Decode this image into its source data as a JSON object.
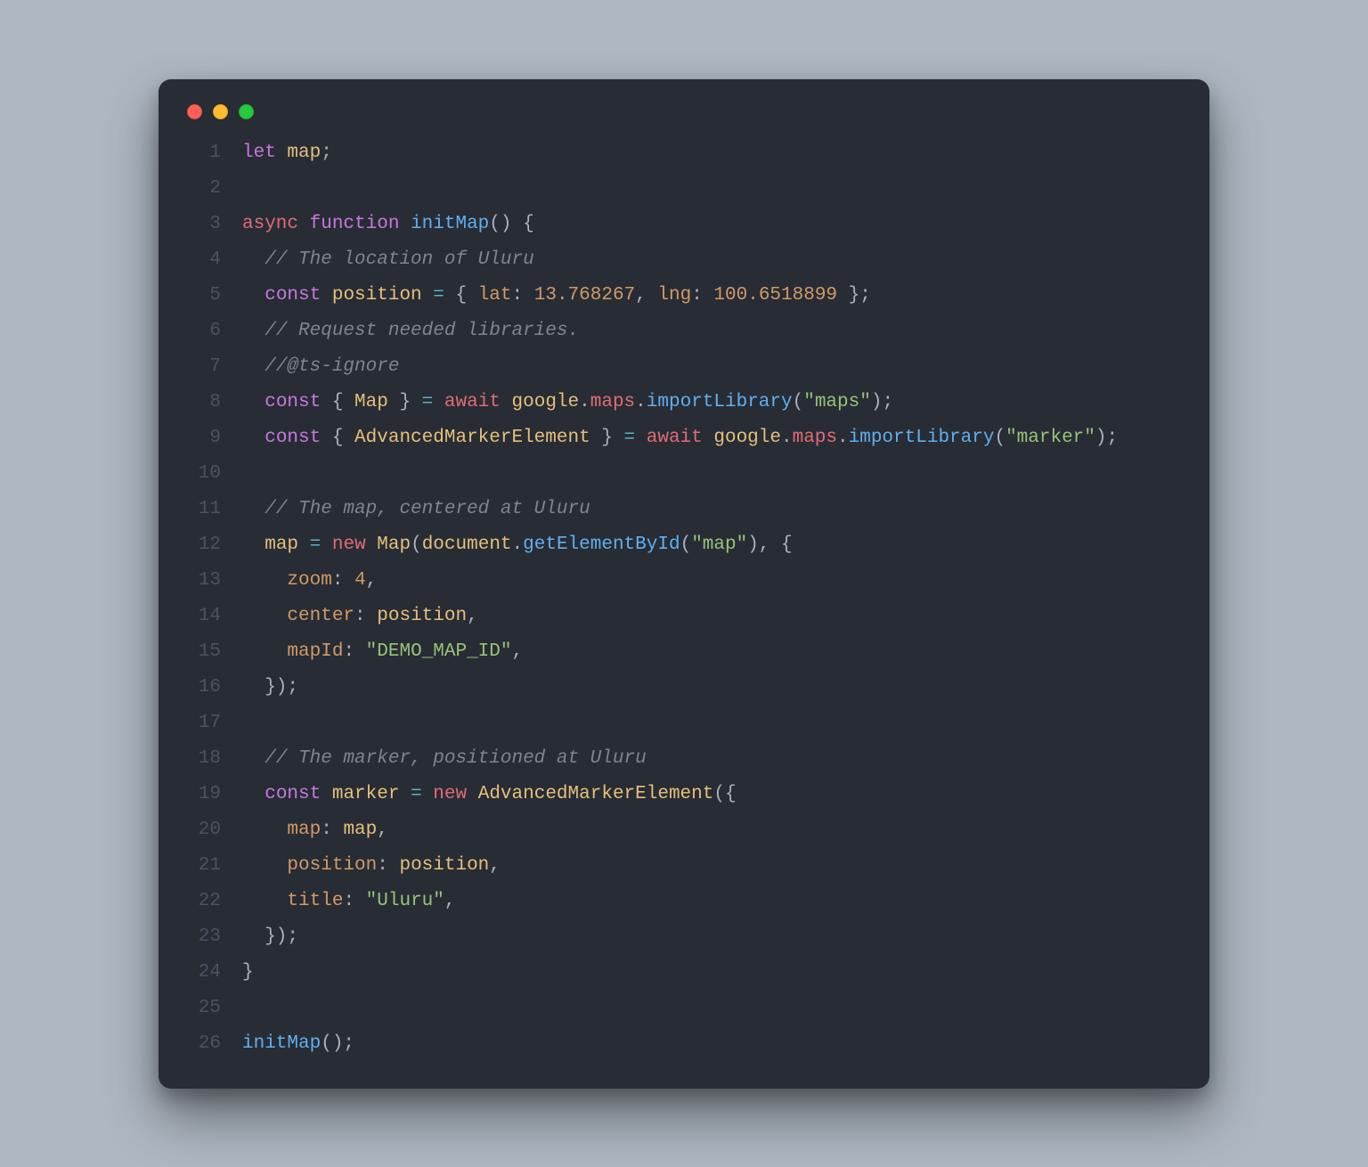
{
  "window": {
    "traffic_light_colors": {
      "close": "#ff5f56",
      "minimize": "#ffbd2e",
      "zoom": "#27c93f"
    }
  },
  "editor": {
    "theme": "one-dark",
    "background": "#282c34",
    "font": "monospace",
    "line_numbers": [
      "1",
      "2",
      "3",
      "4",
      "5",
      "6",
      "7",
      "8",
      "9",
      "10",
      "11",
      "12",
      "13",
      "14",
      "15",
      "16",
      "17",
      "18",
      "19",
      "20",
      "21",
      "22",
      "23",
      "24",
      "25",
      "26"
    ],
    "lines": [
      [
        {
          "t": "let",
          "c": "tk-kw"
        },
        {
          "t": " ",
          "c": "tk-punc"
        },
        {
          "t": "map",
          "c": "tk-var"
        },
        {
          "t": ";",
          "c": "tk-punc"
        }
      ],
      [],
      [
        {
          "t": "async",
          "c": "tk-def"
        },
        {
          "t": " ",
          "c": "tk-punc"
        },
        {
          "t": "function",
          "c": "tk-kw"
        },
        {
          "t": " ",
          "c": "tk-punc"
        },
        {
          "t": "initMap",
          "c": "tk-call"
        },
        {
          "t": "() {",
          "c": "tk-punc"
        }
      ],
      [
        {
          "t": "  ",
          "c": "tk-punc"
        },
        {
          "t": "// The location of Uluru",
          "c": "tk-cmnt"
        }
      ],
      [
        {
          "t": "  ",
          "c": "tk-punc"
        },
        {
          "t": "const",
          "c": "tk-kw"
        },
        {
          "t": " ",
          "c": "tk-punc"
        },
        {
          "t": "position",
          "c": "tk-var"
        },
        {
          "t": " ",
          "c": "tk-punc"
        },
        {
          "t": "=",
          "c": "tk-op"
        },
        {
          "t": " { ",
          "c": "tk-punc"
        },
        {
          "t": "lat",
          "c": "tk-attr"
        },
        {
          "t": ": ",
          "c": "tk-punc"
        },
        {
          "t": "13.768267",
          "c": "tk-num"
        },
        {
          "t": ", ",
          "c": "tk-punc"
        },
        {
          "t": "lng",
          "c": "tk-attr"
        },
        {
          "t": ": ",
          "c": "tk-punc"
        },
        {
          "t": "100.6518899",
          "c": "tk-num"
        },
        {
          "t": " };",
          "c": "tk-punc"
        }
      ],
      [
        {
          "t": "  ",
          "c": "tk-punc"
        },
        {
          "t": "// Request needed libraries.",
          "c": "tk-cmnt"
        }
      ],
      [
        {
          "t": "  ",
          "c": "tk-punc"
        },
        {
          "t": "//@ts-ignore",
          "c": "tk-cmnt"
        }
      ],
      [
        {
          "t": "  ",
          "c": "tk-punc"
        },
        {
          "t": "const",
          "c": "tk-kw"
        },
        {
          "t": " { ",
          "c": "tk-punc"
        },
        {
          "t": "Map",
          "c": "tk-type"
        },
        {
          "t": " } ",
          "c": "tk-punc"
        },
        {
          "t": "=",
          "c": "tk-op"
        },
        {
          "t": " ",
          "c": "tk-punc"
        },
        {
          "t": "await",
          "c": "tk-def"
        },
        {
          "t": " ",
          "c": "tk-punc"
        },
        {
          "t": "google",
          "c": "tk-var"
        },
        {
          "t": ".",
          "c": "tk-punc"
        },
        {
          "t": "maps",
          "c": "tk-prop"
        },
        {
          "t": ".",
          "c": "tk-punc"
        },
        {
          "t": "importLibrary",
          "c": "tk-call"
        },
        {
          "t": "(",
          "c": "tk-punc"
        },
        {
          "t": "\"maps\"",
          "c": "tk-str"
        },
        {
          "t": ");",
          "c": "tk-punc"
        }
      ],
      [
        {
          "t": "  ",
          "c": "tk-punc"
        },
        {
          "t": "const",
          "c": "tk-kw"
        },
        {
          "t": " { ",
          "c": "tk-punc"
        },
        {
          "t": "AdvancedMarkerElement",
          "c": "tk-type"
        },
        {
          "t": " } ",
          "c": "tk-punc"
        },
        {
          "t": "=",
          "c": "tk-op"
        },
        {
          "t": " ",
          "c": "tk-punc"
        },
        {
          "t": "await",
          "c": "tk-def"
        },
        {
          "t": " ",
          "c": "tk-punc"
        },
        {
          "t": "google",
          "c": "tk-var"
        },
        {
          "t": ".",
          "c": "tk-punc"
        },
        {
          "t": "maps",
          "c": "tk-prop"
        },
        {
          "t": ".",
          "c": "tk-punc"
        },
        {
          "t": "importLibrary",
          "c": "tk-call"
        },
        {
          "t": "(",
          "c": "tk-punc"
        },
        {
          "t": "\"marker\"",
          "c": "tk-str"
        },
        {
          "t": ");",
          "c": "tk-punc"
        }
      ],
      [],
      [
        {
          "t": "  ",
          "c": "tk-punc"
        },
        {
          "t": "// The map, centered at Uluru",
          "c": "tk-cmnt"
        }
      ],
      [
        {
          "t": "  ",
          "c": "tk-punc"
        },
        {
          "t": "map",
          "c": "tk-var"
        },
        {
          "t": " ",
          "c": "tk-punc"
        },
        {
          "t": "=",
          "c": "tk-op"
        },
        {
          "t": " ",
          "c": "tk-punc"
        },
        {
          "t": "new",
          "c": "tk-def"
        },
        {
          "t": " ",
          "c": "tk-punc"
        },
        {
          "t": "Map",
          "c": "tk-type"
        },
        {
          "t": "(",
          "c": "tk-punc"
        },
        {
          "t": "document",
          "c": "tk-var"
        },
        {
          "t": ".",
          "c": "tk-punc"
        },
        {
          "t": "getElementById",
          "c": "tk-call"
        },
        {
          "t": "(",
          "c": "tk-punc"
        },
        {
          "t": "\"map\"",
          "c": "tk-str"
        },
        {
          "t": "), {",
          "c": "tk-punc"
        }
      ],
      [
        {
          "t": "    ",
          "c": "tk-punc"
        },
        {
          "t": "zoom",
          "c": "tk-attr"
        },
        {
          "t": ": ",
          "c": "tk-punc"
        },
        {
          "t": "4",
          "c": "tk-num"
        },
        {
          "t": ",",
          "c": "tk-punc"
        }
      ],
      [
        {
          "t": "    ",
          "c": "tk-punc"
        },
        {
          "t": "center",
          "c": "tk-attr"
        },
        {
          "t": ": ",
          "c": "tk-punc"
        },
        {
          "t": "position",
          "c": "tk-var"
        },
        {
          "t": ",",
          "c": "tk-punc"
        }
      ],
      [
        {
          "t": "    ",
          "c": "tk-punc"
        },
        {
          "t": "mapId",
          "c": "tk-attr"
        },
        {
          "t": ": ",
          "c": "tk-punc"
        },
        {
          "t": "\"DEMO_MAP_ID\"",
          "c": "tk-str"
        },
        {
          "t": ",",
          "c": "tk-punc"
        }
      ],
      [
        {
          "t": "  });",
          "c": "tk-punc"
        }
      ],
      [],
      [
        {
          "t": "  ",
          "c": "tk-punc"
        },
        {
          "t": "// The marker, positioned at Uluru",
          "c": "tk-cmnt"
        }
      ],
      [
        {
          "t": "  ",
          "c": "tk-punc"
        },
        {
          "t": "const",
          "c": "tk-kw"
        },
        {
          "t": " ",
          "c": "tk-punc"
        },
        {
          "t": "marker",
          "c": "tk-var"
        },
        {
          "t": " ",
          "c": "tk-punc"
        },
        {
          "t": "=",
          "c": "tk-op"
        },
        {
          "t": " ",
          "c": "tk-punc"
        },
        {
          "t": "new",
          "c": "tk-def"
        },
        {
          "t": " ",
          "c": "tk-punc"
        },
        {
          "t": "AdvancedMarkerElement",
          "c": "tk-type"
        },
        {
          "t": "({",
          "c": "tk-punc"
        }
      ],
      [
        {
          "t": "    ",
          "c": "tk-punc"
        },
        {
          "t": "map",
          "c": "tk-attr"
        },
        {
          "t": ": ",
          "c": "tk-punc"
        },
        {
          "t": "map",
          "c": "tk-var"
        },
        {
          "t": ",",
          "c": "tk-punc"
        }
      ],
      [
        {
          "t": "    ",
          "c": "tk-punc"
        },
        {
          "t": "position",
          "c": "tk-attr"
        },
        {
          "t": ": ",
          "c": "tk-punc"
        },
        {
          "t": "position",
          "c": "tk-var"
        },
        {
          "t": ",",
          "c": "tk-punc"
        }
      ],
      [
        {
          "t": "    ",
          "c": "tk-punc"
        },
        {
          "t": "title",
          "c": "tk-attr"
        },
        {
          "t": ": ",
          "c": "tk-punc"
        },
        {
          "t": "\"Uluru\"",
          "c": "tk-str"
        },
        {
          "t": ",",
          "c": "tk-punc"
        }
      ],
      [
        {
          "t": "  });",
          "c": "tk-punc"
        }
      ],
      [
        {
          "t": "}",
          "c": "tk-punc"
        }
      ],
      [],
      [
        {
          "t": "initMap",
          "c": "tk-call"
        },
        {
          "t": "();",
          "c": "tk-punc"
        }
      ]
    ]
  }
}
